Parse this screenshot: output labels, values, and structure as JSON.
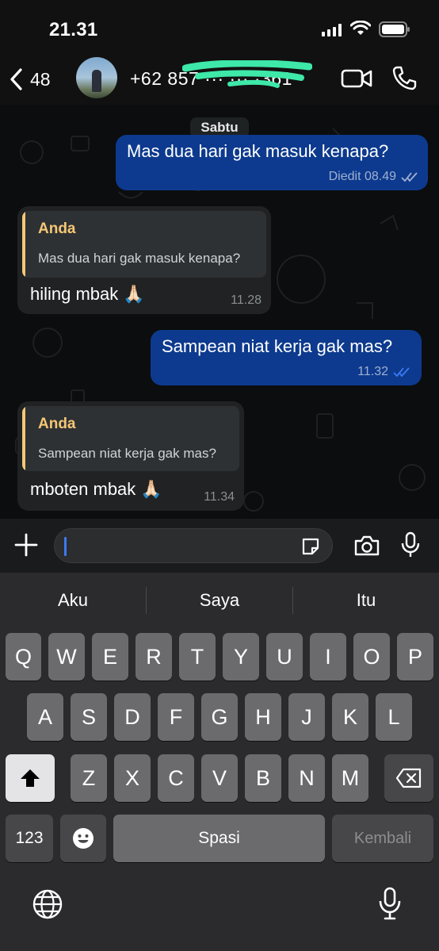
{
  "status_bar": {
    "time": "21.31"
  },
  "header": {
    "back_count": "48",
    "contact_name": "+62 857 ··· ··· ·361"
  },
  "chat": {
    "date_label": "Sabtu",
    "messages": [
      {
        "direction": "out",
        "text": "Mas dua hari gak masuk kenapa?",
        "meta": "Diedit 08.49"
      },
      {
        "direction": "in",
        "quote_author": "Anda",
        "quote_text": "Mas dua hari gak masuk kenapa?",
        "text": "hiling mbak",
        "emoji": "🙏🏻",
        "time": "11.28"
      },
      {
        "direction": "out",
        "text": "Sampean niat kerja gak mas?",
        "meta": "11.32"
      },
      {
        "direction": "in",
        "quote_author": "Anda",
        "quote_text": "Sampean niat kerja gak mas?",
        "text": "mboten mbak",
        "emoji": "🙏🏻",
        "time": "11.34"
      }
    ]
  },
  "input": {
    "placeholder": ""
  },
  "keyboard": {
    "suggestions": [
      "Aku",
      "Saya",
      "Itu"
    ],
    "row1": [
      "Q",
      "W",
      "E",
      "R",
      "T",
      "Y",
      "U",
      "I",
      "O",
      "P"
    ],
    "row2": [
      "A",
      "S",
      "D",
      "F",
      "G",
      "H",
      "J",
      "K",
      "L"
    ],
    "row3": [
      "Z",
      "X",
      "C",
      "V",
      "B",
      "N",
      "M"
    ],
    "numbers_key": "123",
    "space_key": "Spasi",
    "return_key": "Kembali"
  },
  "icons": {
    "signal": "signal-icon",
    "wifi": "wifi-icon",
    "battery": "battery-icon",
    "back": "chevron-left-icon",
    "video": "video-camera-icon",
    "phone": "phone-icon",
    "add": "plus-icon",
    "sticker": "sticker-icon",
    "camera": "camera-icon",
    "mic": "microphone-icon",
    "shift": "shift-icon",
    "delete": "backspace-icon",
    "emoji": "emoji-icon",
    "globe": "globe-icon"
  },
  "colors": {
    "outgoing_bubble": "#0d3a8e",
    "incoming_bubble": "#202223",
    "quote_accent": "#f5c776",
    "read_ticks": "#3a7bf5"
  }
}
